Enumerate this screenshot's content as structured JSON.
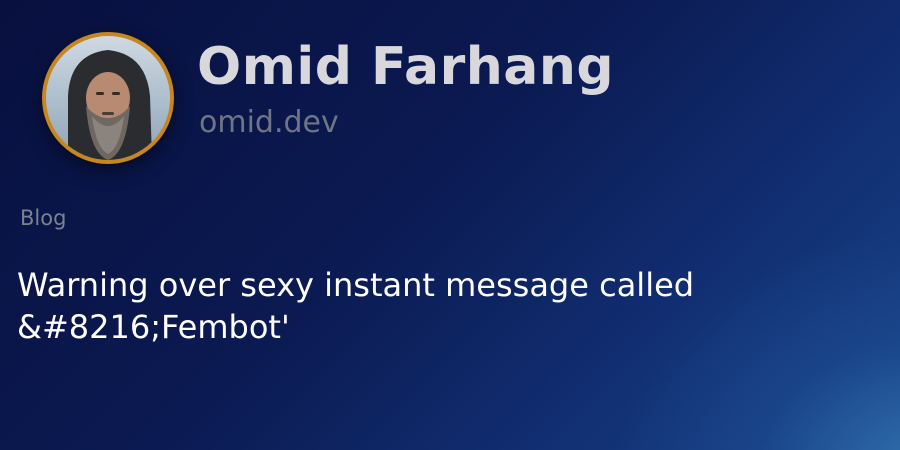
{
  "profile": {
    "name": "Omid Farhang",
    "site": "omid.dev",
    "avatar_icon": "profile-photo"
  },
  "post": {
    "section": "Blog",
    "title": "Warning over sexy instant message called &#8216;Fembot'"
  },
  "colors": {
    "avatar_ring": "#c8861e",
    "background_dark": "#08103f",
    "background_light": "#1a4488",
    "name_text": "#d8d8dc",
    "site_text": "#6f7584",
    "title_text": "#ffffff"
  }
}
